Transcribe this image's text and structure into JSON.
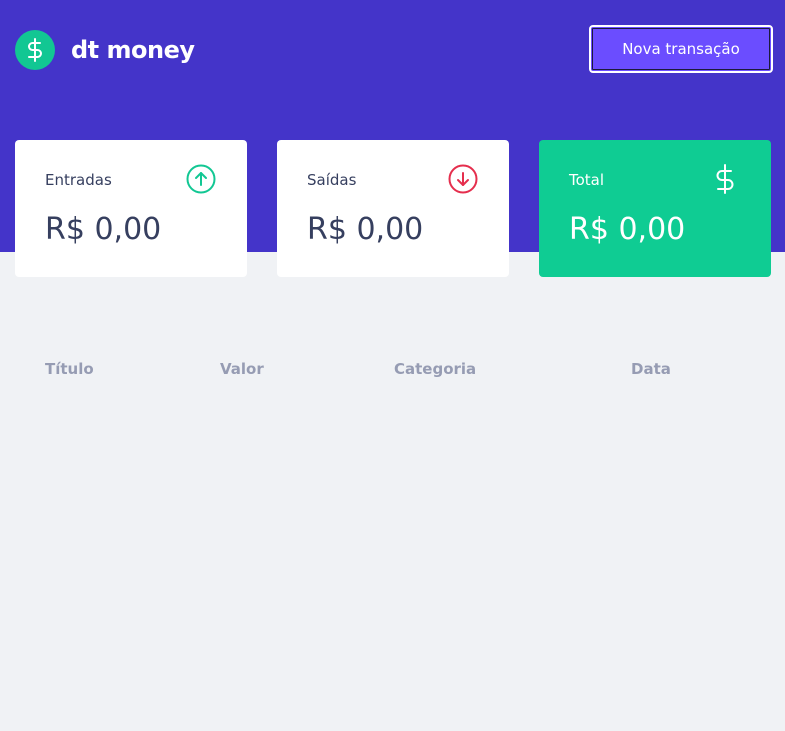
{
  "app": {
    "logo_icon": "dollar-icon",
    "name": "dt money"
  },
  "header": {
    "new_transaction_label": "Nova transação"
  },
  "summary": {
    "income": {
      "label": "Entradas",
      "value": "R$ 0,00",
      "icon": "arrow-up-circle-icon",
      "color": "#12c793"
    },
    "outcome": {
      "label": "Saídas",
      "value": "R$ 0,00",
      "icon": "arrow-down-circle-icon",
      "color": "#e52e4d"
    },
    "total": {
      "label": "Total",
      "value": "R$ 0,00",
      "icon": "dollar-sign-icon",
      "color": "#0fcc93"
    }
  },
  "table": {
    "headers": [
      "Título",
      "Valor",
      "Categoria",
      "Data"
    ],
    "rows": []
  },
  "colors": {
    "brand": "#4434c9",
    "button": "#6b4dff",
    "background": "#f0f2f5"
  }
}
